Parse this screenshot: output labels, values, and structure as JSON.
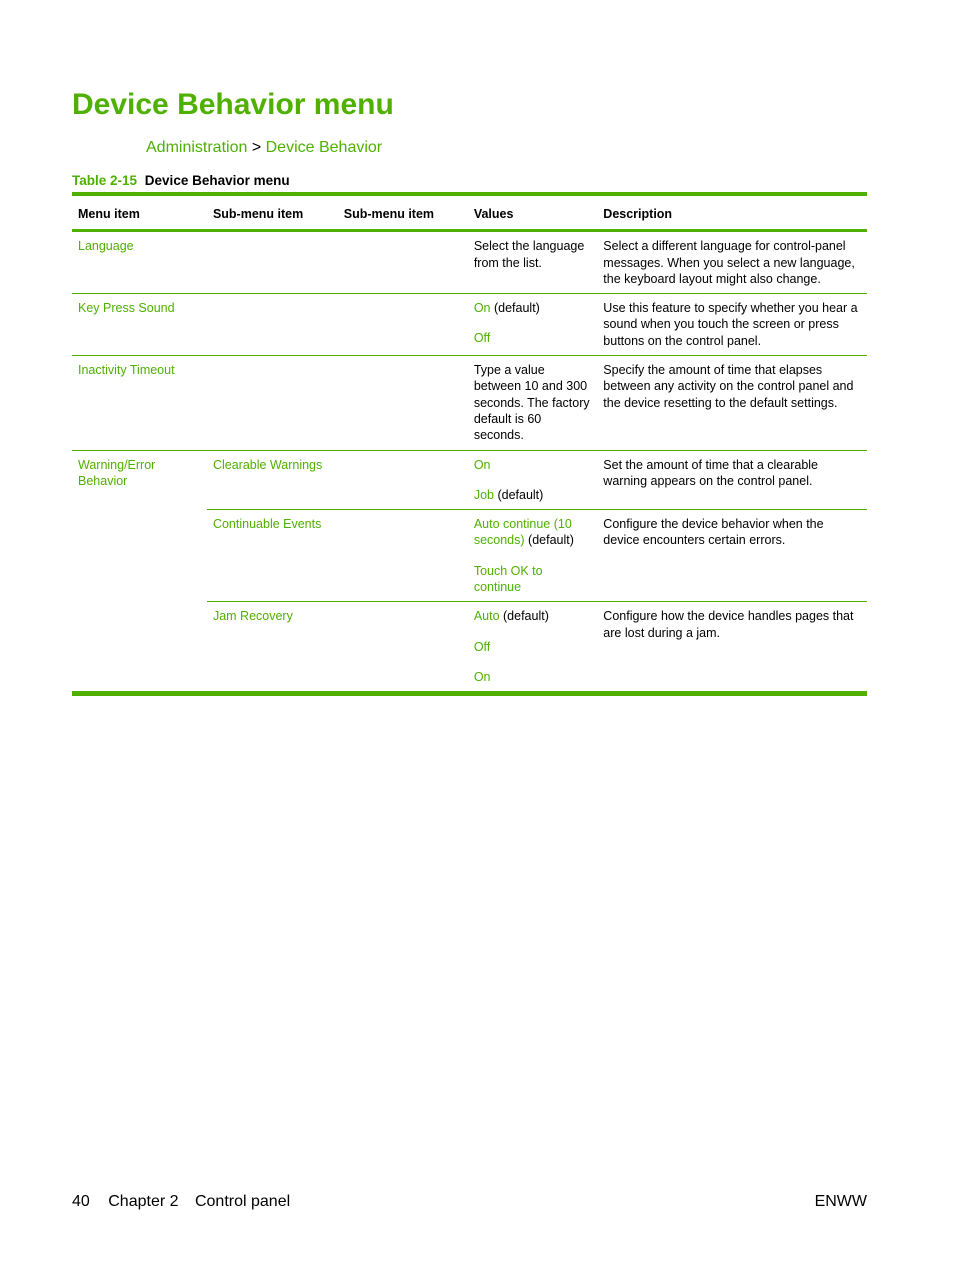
{
  "page": {
    "title": "Device Behavior menu",
    "breadcrumb": {
      "parent": "Administration",
      "separator": ">",
      "current": "Device Behavior"
    },
    "caption": {
      "number": "Table 2-15",
      "title": "Device Behavior menu"
    }
  },
  "table": {
    "headers": [
      "Menu item",
      "Sub-menu item",
      "Sub-menu item",
      "Values",
      "Description"
    ],
    "rows": [
      {
        "menu_item": "Language",
        "sub_item_1": "",
        "sub_item_2": "",
        "values_text": "Select the language from the list.",
        "description": "Select a different language for control-panel messages. When you select a new language, the keyboard layout might also change."
      },
      {
        "menu_item": "Key Press Sound",
        "sub_item_1": "",
        "sub_item_2": "",
        "values": [
          {
            "option": "On",
            "suffix": "(default)"
          },
          {
            "option": "Off",
            "suffix": ""
          }
        ],
        "description": "Use this feature to specify whether you hear a sound when you touch the screen or press buttons on the control panel."
      },
      {
        "menu_item": "Inactivity Timeout",
        "sub_item_1": "",
        "sub_item_2": "",
        "values_text": "Type a value between 10 and 300 seconds. The factory default is 60 seconds.",
        "description": "Specify the amount of time that elapses between any activity on the control panel and the device resetting to the default settings."
      },
      {
        "menu_item": "Warning/Error Behavior",
        "sub_item_1": "Clearable Warnings",
        "sub_item_2": "",
        "values": [
          {
            "option": "On",
            "suffix": ""
          },
          {
            "option": "Job",
            "suffix": "(default)"
          }
        ],
        "description": "Set the amount of time that a clearable warning appears on the control panel."
      },
      {
        "menu_item": "",
        "sub_item_1": "Continuable Events",
        "sub_item_2": "",
        "values": [
          {
            "option": "Auto continue (10 seconds)",
            "suffix": "(default)"
          },
          {
            "option": "Touch OK to continue",
            "suffix": ""
          }
        ],
        "description": "Configure the device behavior when the device encounters certain errors."
      },
      {
        "menu_item": "",
        "sub_item_1": "Jam Recovery",
        "sub_item_2": "",
        "values": [
          {
            "option": "Auto",
            "suffix": "(default)"
          },
          {
            "option": "Off",
            "suffix": ""
          },
          {
            "option": "On",
            "suffix": ""
          }
        ],
        "description": "Configure how the device handles pages that are lost during a jam."
      }
    ]
  },
  "footer": {
    "page_number": "40",
    "chapter": "Chapter 2",
    "section": "Control panel",
    "right_label": "ENWW"
  },
  "colors": {
    "accent_green": "#4fb000",
    "text": "#000000"
  }
}
